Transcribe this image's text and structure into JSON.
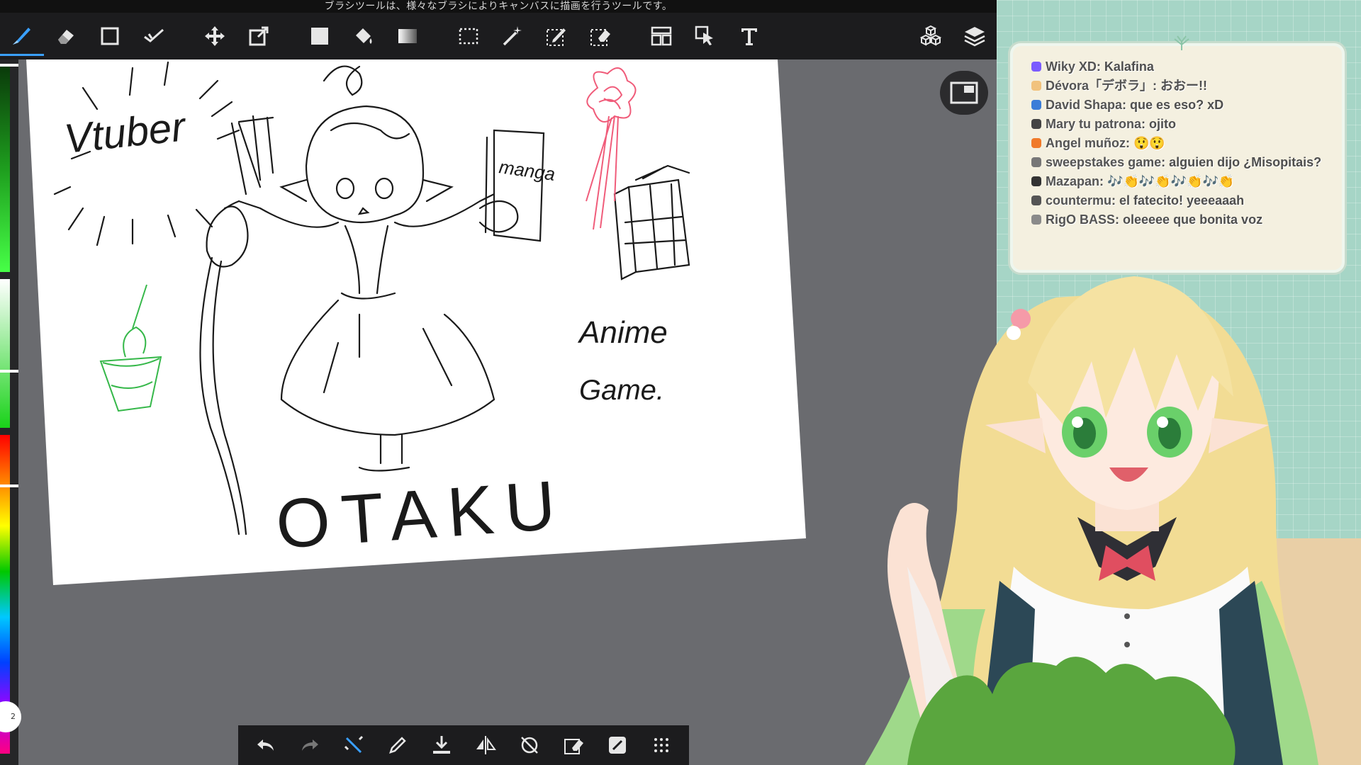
{
  "app": {
    "hint_text": "ブラシツールは、様々なブラシによりキャンバスに描画を行うツールです。",
    "toolbar": {
      "left_tools": [
        "brush-tool",
        "eraser-tool",
        "shape-tool",
        "smudge-tool",
        "move-tool",
        "transform-tool",
        "fill-color-swatch",
        "bucket-tool",
        "gradient-tool",
        "select-tool",
        "magic-wand-tool",
        "select-pen-tool",
        "select-eraser-tool",
        "frame-divider-tool",
        "operation-tool",
        "text-tool"
      ],
      "right_tools": [
        "materials-tool",
        "layers-tool"
      ]
    },
    "brush_size_label": "2",
    "bottom_bar": [
      "undo",
      "redo",
      "transform",
      "eyedropper",
      "save",
      "flip",
      "rotate-reset",
      "select-clear",
      "edit",
      "menu"
    ]
  },
  "canvas": {
    "texts": {
      "vtuber": "Vtuber",
      "manga": "manga",
      "anime": "Anime",
      "game": "Game.",
      "otaku": "OTAKU"
    },
    "colors": {
      "sketch": "#1a1a1a",
      "pink": "#f05c7a",
      "green": "#36b84a"
    }
  },
  "chat": {
    "messages": [
      {
        "user": "Wiky XD",
        "text": "Kalafina",
        "badge": "#7b5cff"
      },
      {
        "user": "Dévora「デボラ」",
        "text": "おおー!!",
        "badge": "#f1c27d"
      },
      {
        "user": "David Shapa",
        "text": "que es eso? xD",
        "badge": "#3b7dd8"
      },
      {
        "user": "Mary tu patrona",
        "text": "ojito",
        "badge": "#444444"
      },
      {
        "user": "Angel muñoz",
        "text": "😲😲",
        "badge": "#f07a2a"
      },
      {
        "user": "sweepstakes game",
        "text": "alguien dijo ¿Misopitais?",
        "badge": "#777777"
      },
      {
        "user": "Mazapan",
        "text": "🎶👏🎶👏🎶👏🎶👏",
        "badge": "#333333"
      },
      {
        "user": "countermu",
        "text": "el fatecito! yeeeaaah",
        "badge": "#555555"
      },
      {
        "user": "RigO BASS",
        "text": "oleeeee que bonita voz",
        "badge": "#8a8a8a"
      }
    ]
  },
  "theme": {
    "overlay_bg": "#a6d5c6",
    "panel_bg": "#f4f0e0",
    "toolbar_bg": "#1c1c1e",
    "accent": "#3aa0ff"
  }
}
